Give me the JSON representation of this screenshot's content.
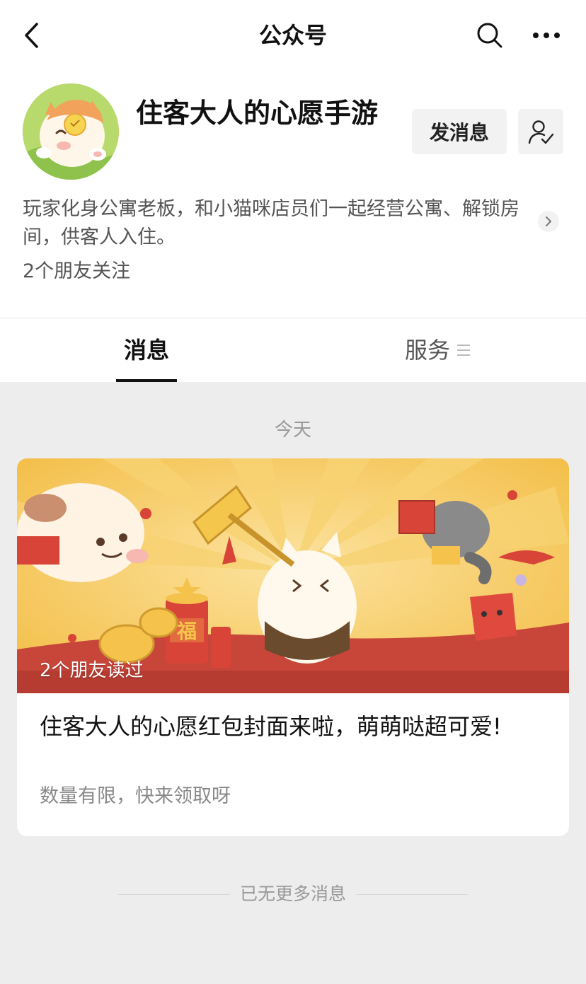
{
  "nav": {
    "title": "公众号"
  },
  "account": {
    "name": "住客大人的心愿手游",
    "send_message_label": "发消息",
    "description": "玩家化身公寓老板，和小猫咪店员们一起经营公寓、解锁房间，供客人入住。",
    "friends_following": "2个朋友关注"
  },
  "tabs": [
    {
      "label": "消息",
      "selected": true
    },
    {
      "label": "服务",
      "selected": false
    }
  ],
  "feed": {
    "date_label": "今天",
    "articles": [
      {
        "read_by": "2个朋友读过",
        "title": "住客大人的心愿红包封面来啦，萌萌哒超可爱!",
        "subtitle": "数量有限，快来领取呀",
        "cover_sign_char": "福"
      }
    ],
    "end_label": "已无更多消息"
  },
  "colors": {
    "background": "#ededed",
    "cover_yellow": "#f6c54b",
    "cover_red": "#c8453a"
  }
}
